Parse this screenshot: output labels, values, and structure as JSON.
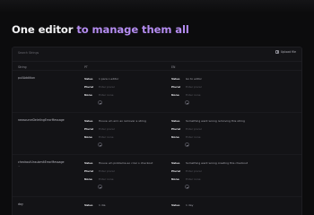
{
  "headline": {
    "part1": "One editor",
    "part2": "to manage them all"
  },
  "toolbar": {
    "search_placeholder": "Search Strings",
    "upload_label": "Upload file"
  },
  "columns": {
    "string": "String",
    "lang1": "PT",
    "lang2": "EN"
  },
  "field_labels": {
    "value": "Value",
    "plural": "Plural",
    "none": "None"
  },
  "placeholder": "Enter plural",
  "placeholder_none": "Enter none",
  "rows": [
    {
      "key": "pullAddition",
      "pt_value": "1 para o editor",
      "en_value": "Go to editor"
    },
    {
      "key": "rawsourceDeletingErrorMessage",
      "pt_value": "Houve um erro ao remover a string",
      "en_value": "Something went wrong removing this string"
    },
    {
      "key": "checkoutUnsubmitErrorMessage",
      "pt_value": "Houve um problema ao criar o checkout",
      "en_value": "Something went wrong creating this checkout"
    },
    {
      "key": "day",
      "pt_value": "1 dia",
      "en_value": "1 day"
    }
  ],
  "icons": {
    "upload": "upload-icon",
    "add": "plus-circle-icon"
  }
}
